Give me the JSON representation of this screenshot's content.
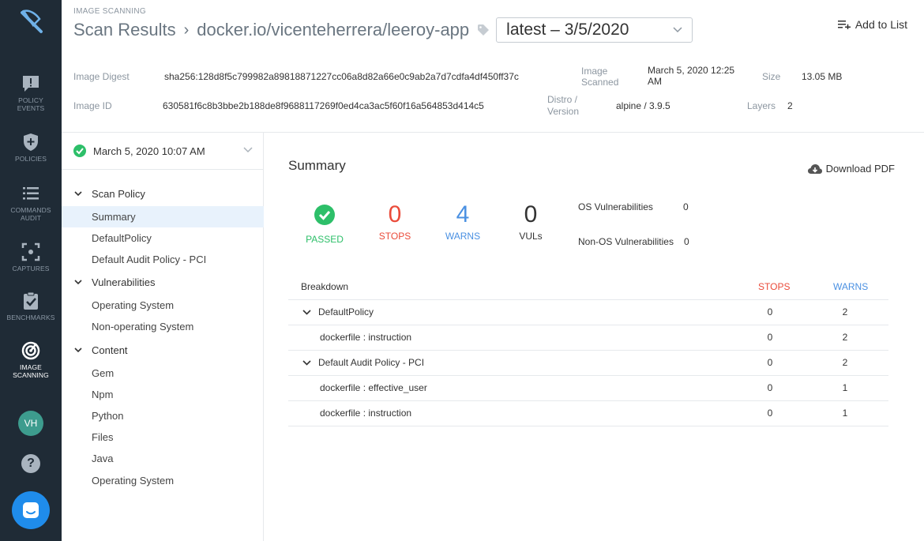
{
  "nav": {
    "items": [
      {
        "label_1": "POLICY",
        "label_2": "EVENTS",
        "icon": "alert-message-icon"
      },
      {
        "label_1": "POLICIES",
        "label_2": "",
        "icon": "shield-icon"
      },
      {
        "label_1": "COMMANDS",
        "label_2": "AUDIT",
        "icon": "list-icon"
      },
      {
        "label_1": "CAPTURES",
        "label_2": "",
        "icon": "capture-icon"
      },
      {
        "label_1": "BENCHMARKS",
        "label_2": "",
        "icon": "clipboard-check-icon"
      },
      {
        "label_1": "IMAGE",
        "label_2": "SCANNING",
        "icon": "scan-target-icon"
      }
    ],
    "avatar": "VH",
    "help": "?"
  },
  "header": {
    "section": "IMAGE SCANNING",
    "title": "Scan Results",
    "separator": "›",
    "image_name": "docker.io/vicenteherrera/leeroy-app",
    "tag_value": "latest – 3/5/2020",
    "add_to_list": "Add to List"
  },
  "meta": {
    "digest_label": "Image Digest",
    "digest_value": "sha256:128d8f5c799982a89818871227cc06a8d82a66e0c9ab2a7d7cdfa4df450ff37c",
    "id_label": "Image ID",
    "id_value": "630581f6c8b3bbe2b188de8f9688117269f0ed4ca3ac5f60f16a564853d414c5",
    "scanned_label_1": "Image",
    "scanned_label_2": "Scanned",
    "scanned_value_1": "March 5, 2020 12:25",
    "scanned_value_2": "AM",
    "distro_label_1": "Distro /",
    "distro_label_2": "Version",
    "distro_value": "alpine / 3.9.5",
    "size_label": "Size",
    "size_value": "13.05 MB",
    "layers_label": "Layers",
    "layers_value": "2"
  },
  "side": {
    "scan_date": "March 5, 2020 10:07 AM",
    "groups": [
      {
        "label": "Scan Policy",
        "children": [
          "Summary",
          "DefaultPolicy",
          "Default Audit Policy - PCI"
        ]
      },
      {
        "label": "Vulnerabilities",
        "children": [
          "Operating System",
          "Non-operating System"
        ]
      },
      {
        "label": "Content",
        "children": [
          "Gem",
          "Npm",
          "Python",
          "Files",
          "Java",
          "Operating System"
        ]
      }
    ]
  },
  "summary": {
    "title": "Summary",
    "download": "Download PDF",
    "passed_label": "PASSED",
    "stops_num": "0",
    "stops_label": "STOPS",
    "warns_num": "4",
    "warns_label": "WARNS",
    "vuls_num": "0",
    "vuls_label": "VULs",
    "os_vuln_label": "OS Vulnerabilities",
    "os_vuln_value": "0",
    "nonos_vuln_label": "Non-OS Vulnerabilities",
    "nonos_vuln_value": "0",
    "colors": {
      "passed": "#2dbf69",
      "stops": "#ea4b3a",
      "warns": "#4a90e2"
    }
  },
  "breakdown": {
    "header": "Breakdown",
    "col_stops": "STOPS",
    "col_warns": "WARNS",
    "rows": [
      {
        "name": "DefaultPolicy",
        "stops": "0",
        "warns": "2"
      },
      {
        "name": "dockerfile : instruction",
        "stops": "0",
        "warns": "2"
      },
      {
        "name": "Default Audit Policy - PCI",
        "stops": "0",
        "warns": "2"
      },
      {
        "name": "dockerfile : effective_user",
        "stops": "0",
        "warns": "1"
      },
      {
        "name": "dockerfile : instruction",
        "stops": "0",
        "warns": "1"
      }
    ]
  }
}
